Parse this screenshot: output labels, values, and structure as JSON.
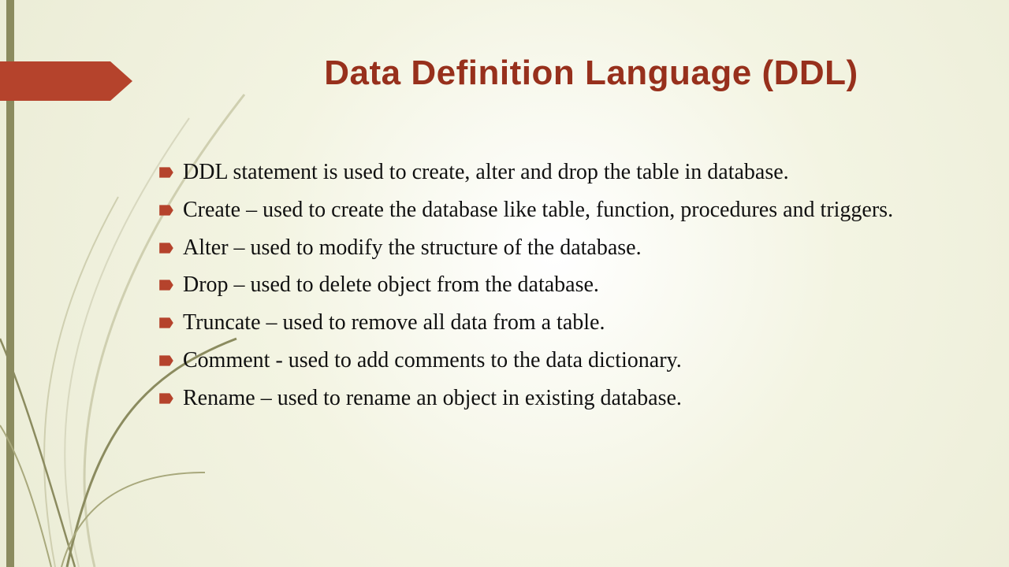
{
  "title": "Data Definition Language (DDL)",
  "bullets": [
    "DDL statement is used to create, alter and drop the table in database.",
    "Create – used to create the database like table, function, procedures and triggers.",
    "Alter – used to modify the structure of the database.",
    "Drop – used to delete object from the database.",
    "Truncate – used to remove all data from a table.",
    "Comment -  used to add comments to the data dictionary.",
    "Rename – used to rename an object in existing database."
  ],
  "colors": {
    "accent": "#b5432c",
    "olive": "#8b8b5f",
    "title": "#97301c"
  }
}
